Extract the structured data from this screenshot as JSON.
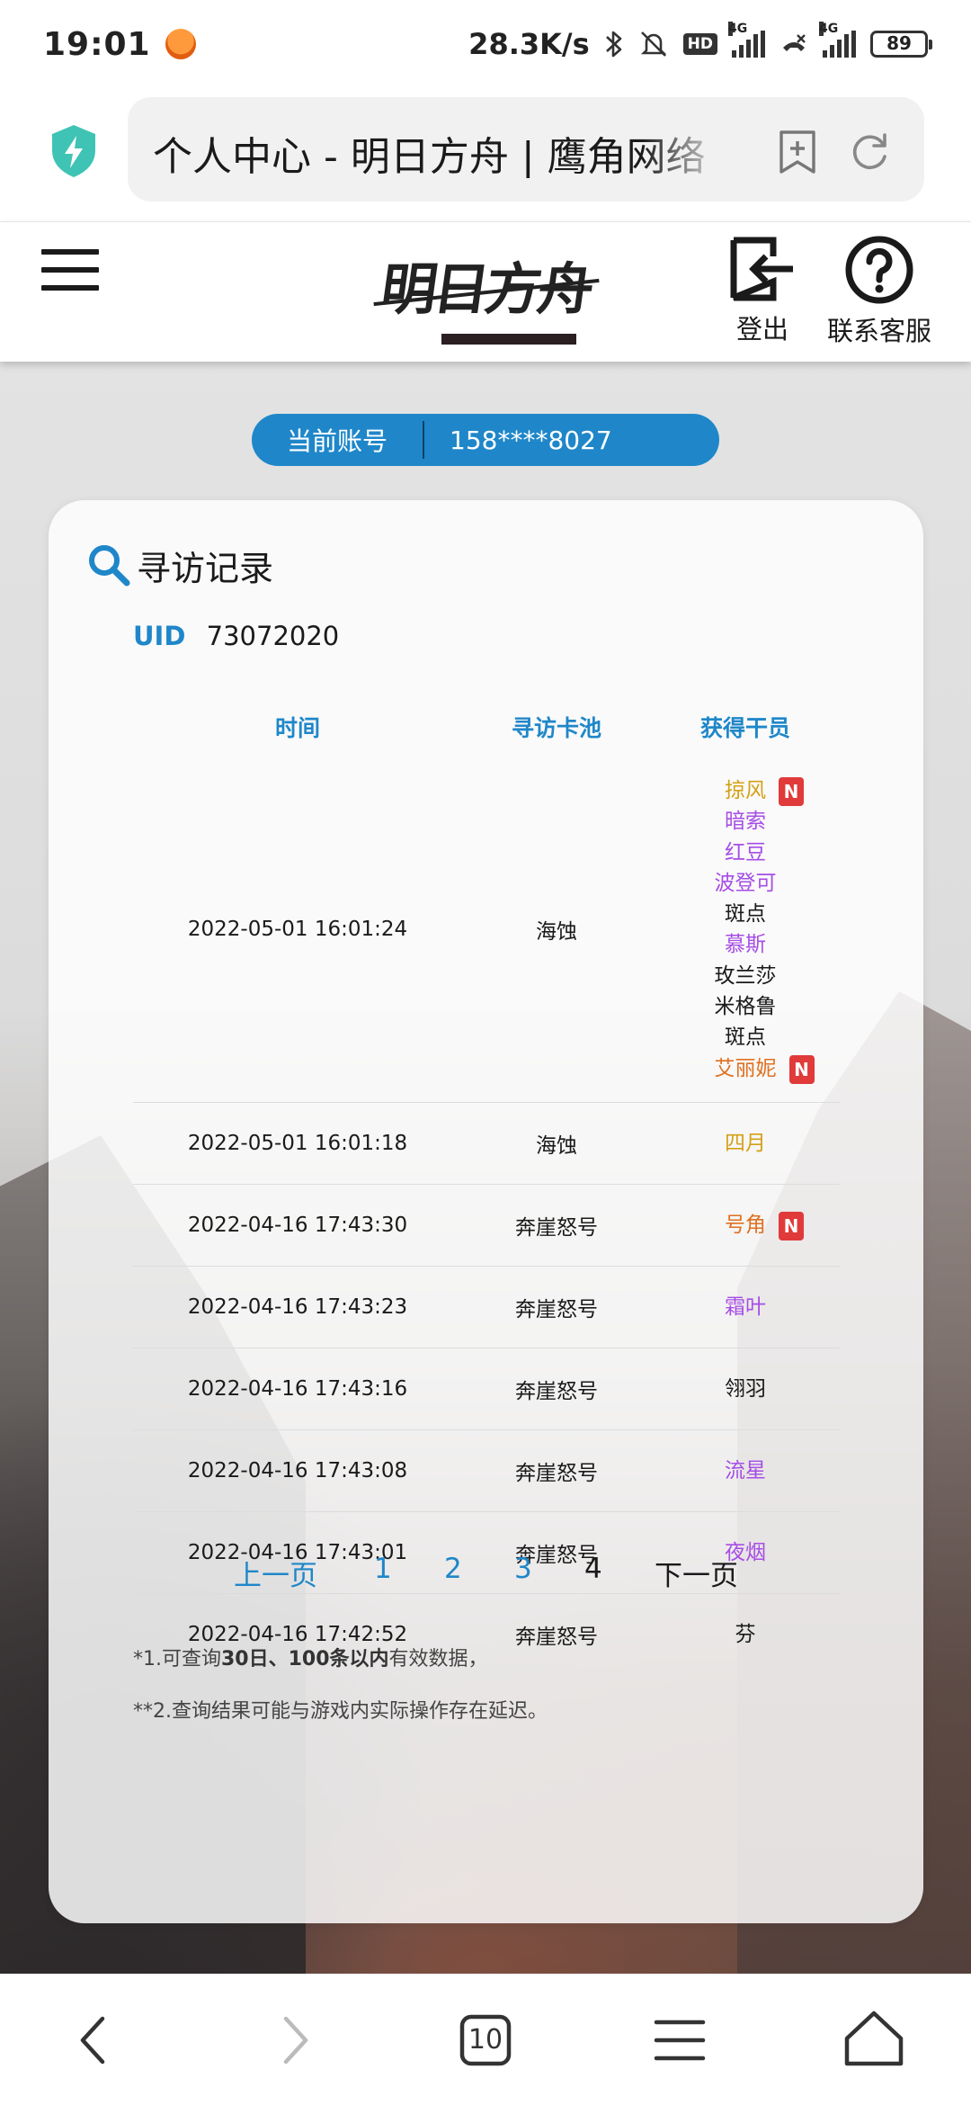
{
  "status_bar": {
    "time": "19:01",
    "network_speed": "28.3K/s",
    "hd_label": "HD",
    "signal_tag_1": "4G",
    "signal_tag_2": "4G",
    "battery": "89",
    "icons": [
      "app-notification-icon",
      "bluetooth-icon",
      "mute-bell-icon",
      "hd-icon",
      "signal-icon",
      "no-call-icon",
      "signal-icon",
      "battery-icon"
    ]
  },
  "browser": {
    "url_title": "个人中心 - 明日方舟 | 鹰角网络",
    "icons": [
      "shield-bolt-icon",
      "bookmark-add-icon",
      "reload-icon"
    ]
  },
  "header": {
    "logo_text": "明日方舟",
    "logout_label": "登出",
    "help_label": "联系客服"
  },
  "account": {
    "label": "当前账号",
    "value": "158****8027"
  },
  "record": {
    "title": "寻访记录",
    "uid_label": "UID",
    "uid_value": "73072020",
    "columns": [
      "时间",
      "寻访卡池",
      "获得干员"
    ],
    "rows": [
      {
        "time": "2022-05-01 16:01:24",
        "pool": "海蚀",
        "operators": [
          {
            "name": "掠风",
            "rarity": 5,
            "new": true
          },
          {
            "name": "暗索",
            "rarity": 4,
            "new": false
          },
          {
            "name": "红豆",
            "rarity": 4,
            "new": false
          },
          {
            "name": "波登可",
            "rarity": 4,
            "new": false
          },
          {
            "name": "斑点",
            "rarity": 3,
            "new": false
          },
          {
            "name": "慕斯",
            "rarity": 4,
            "new": false
          },
          {
            "name": "玫兰莎",
            "rarity": 3,
            "new": false
          },
          {
            "name": "米格鲁",
            "rarity": 3,
            "new": false
          },
          {
            "name": "斑点",
            "rarity": 3,
            "new": false
          },
          {
            "name": "艾丽妮",
            "rarity": 6,
            "new": true
          }
        ]
      },
      {
        "time": "2022-05-01 16:01:18",
        "pool": "海蚀",
        "operators": [
          {
            "name": "四月",
            "rarity": 5,
            "new": false
          }
        ]
      },
      {
        "time": "2022-04-16 17:43:30",
        "pool": "奔崖怒号",
        "operators": [
          {
            "name": "号角",
            "rarity": 6,
            "new": true
          }
        ]
      },
      {
        "time": "2022-04-16 17:43:23",
        "pool": "奔崖怒号",
        "operators": [
          {
            "name": "霜叶",
            "rarity": 4,
            "new": false
          }
        ]
      },
      {
        "time": "2022-04-16 17:43:16",
        "pool": "奔崖怒号",
        "operators": [
          {
            "name": "翎羽",
            "rarity": 3,
            "new": false
          }
        ]
      },
      {
        "time": "2022-04-16 17:43:08",
        "pool": "奔崖怒号",
        "operators": [
          {
            "name": "流星",
            "rarity": 4,
            "new": false
          }
        ]
      },
      {
        "time": "2022-04-16 17:43:01",
        "pool": "奔崖怒号",
        "operators": [
          {
            "name": "夜烟",
            "rarity": 4,
            "new": false
          }
        ]
      },
      {
        "time": "2022-04-16 17:42:52",
        "pool": "奔崖怒号",
        "operators": [
          {
            "name": "芬",
            "rarity": 3,
            "new": false
          }
        ]
      }
    ],
    "new_badge": "N",
    "rarity_colors": {
      "3": "#1a1a1a",
      "4": "#a64de6",
      "5": "#d4a017",
      "6": "#e07020"
    }
  },
  "pagination": {
    "prev": "上一页",
    "pages": [
      "1",
      "2",
      "3",
      "4"
    ],
    "current": "4",
    "next": "下一页"
  },
  "notes": {
    "note1_prefix": "*1.可查询",
    "note1_bold": "30日、100条以内",
    "note1_suffix": "有效数据，",
    "note2": "**2.查询结果可能与游戏内实际操作存在延迟。"
  },
  "bottom_nav": {
    "tab_count": "10",
    "icons": [
      "back-icon",
      "forward-icon",
      "tabs-icon",
      "menu-icon",
      "home-icon"
    ]
  },
  "colors": {
    "accent": "#1f87c9",
    "badge": "#e03a3a"
  }
}
